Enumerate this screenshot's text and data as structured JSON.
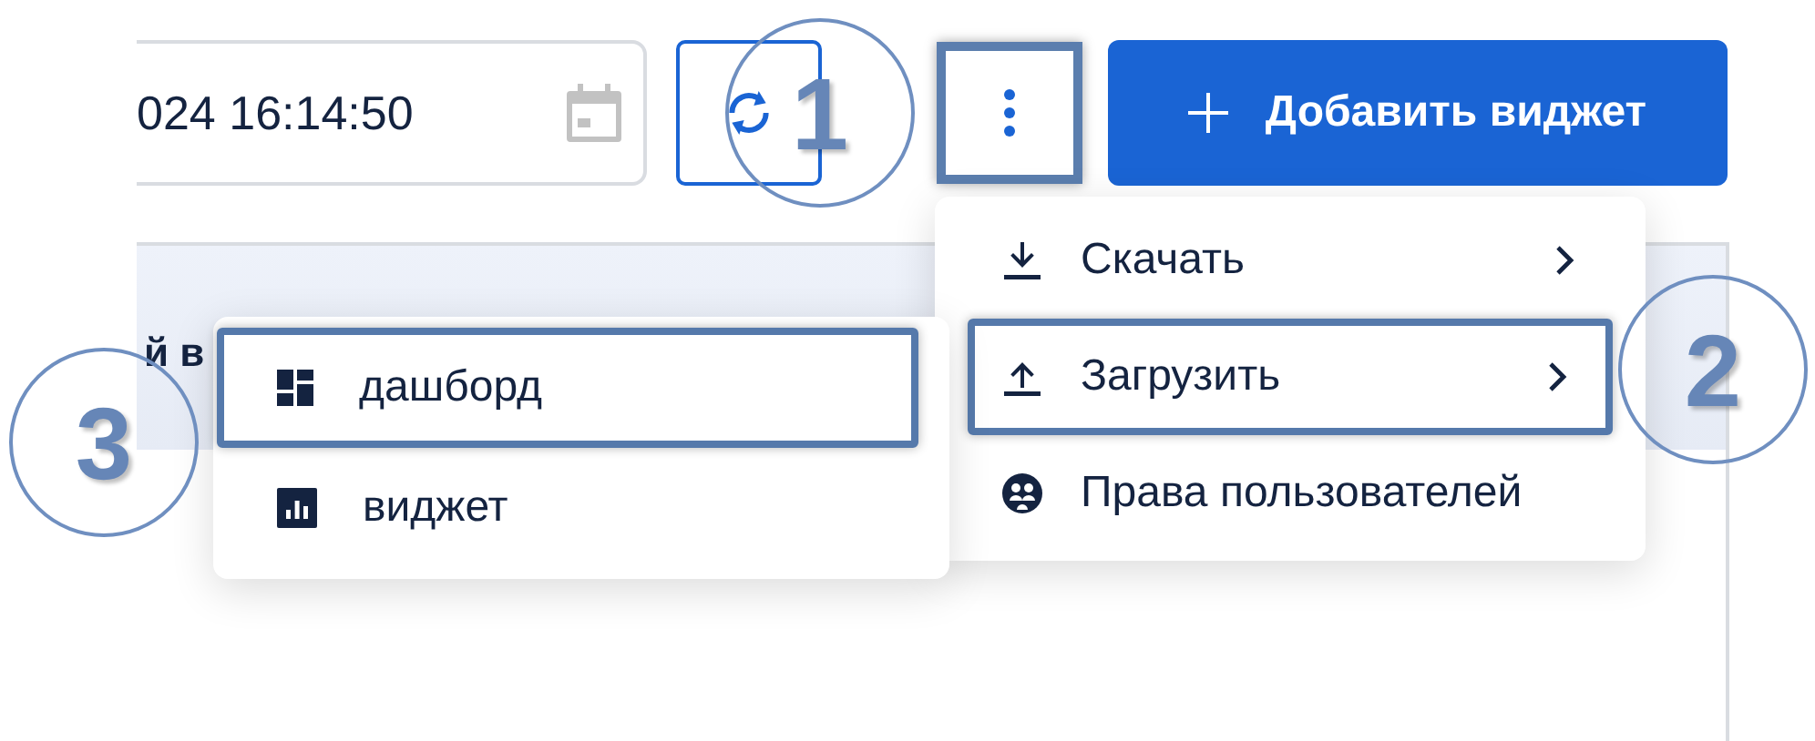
{
  "toolbar": {
    "date_field": {
      "value": "024 16:14:50"
    },
    "more_button": {
      "highlighted": true
    },
    "add_button": {
      "label": "Добавить виджет"
    }
  },
  "panel": {
    "title": "й в"
  },
  "menu": {
    "items": [
      {
        "label": "Скачать",
        "has_submenu": true,
        "highlighted": false
      },
      {
        "label": "Загрузить",
        "has_submenu": true,
        "highlighted": true
      },
      {
        "label": "Права пользователей",
        "has_submenu": false,
        "highlighted": false
      }
    ]
  },
  "submenu": {
    "items": [
      {
        "label": "дашборд",
        "highlighted": true
      },
      {
        "label": "виджет",
        "highlighted": false
      }
    ]
  },
  "annotations": [
    {
      "label": "1"
    },
    {
      "label": "2"
    },
    {
      "label": "3"
    }
  ]
}
